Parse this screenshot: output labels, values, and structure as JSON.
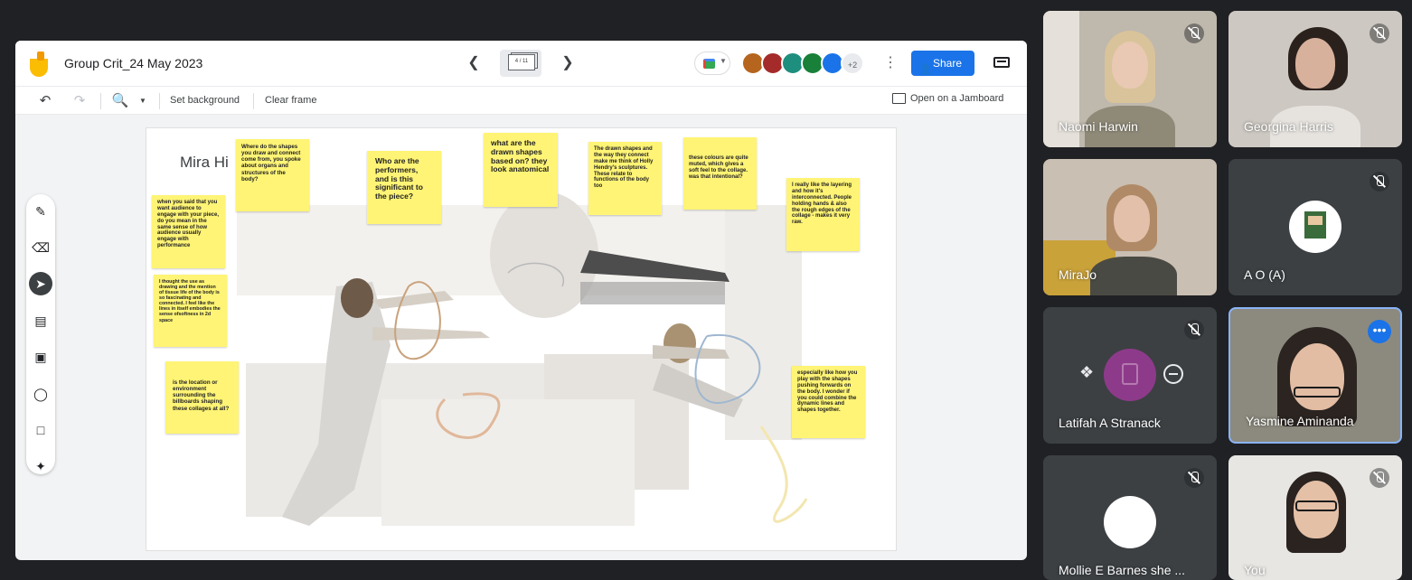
{
  "jamboard": {
    "title": "Group Crit_24 May 2023",
    "frame_indicator": "4 / 11",
    "avatars_more": "+2",
    "share_label": "Share",
    "toolbar": {
      "set_background": "Set background",
      "clear_frame": "Clear frame",
      "open_on_jamboard": "Open on a Jamboard"
    },
    "canvas_title": "Mira Hi",
    "stickies": [
      "Where do the shapes you draw and connect come from, you spoke about organs and structures of the body?",
      "Who are the performers, and is this significant to the piece?",
      "what are the drawn shapes based on? they look anatomical",
      "The drawn shapes and the way they connect make me think of Holly Hendry's sculptures. These relate to functions of the body too",
      "these colours are quite muted, which gives a soft feel to the collage. was that intentional?",
      "when you said that you want audience to engage with your piece, do you mean in the same sense of how audience usually engage with performance",
      "I really like the layering and how it's interconnected. People holding hands & also the rough edges of the collage - makes it very raw.",
      "I thought the use as drawing and the mention of tissue life of the body is so fascinating and connected. I feel like the lines in itself embodies the sense ofsoftness in 2d space",
      "is the location or environment surrounding the billboards shaping these collages at all?",
      "especially like how you play with the shapes pushing forwards on the body. I wonder if you could combine the dynamic lines and shapes together."
    ]
  },
  "meet": {
    "participants": [
      {
        "name": "Naomi Harwin"
      },
      {
        "name": "Georgina Harris"
      },
      {
        "name": "MiraJo"
      },
      {
        "name": "A O (A)"
      },
      {
        "name": "Latifah A Stranack"
      },
      {
        "name": "Yasmine Aminanda"
      },
      {
        "name": "Mollie E Barnes she ..."
      },
      {
        "name": "You"
      }
    ]
  },
  "colors": {
    "background": "#202124",
    "share_blue": "#1a73e8",
    "sticky_yellow": "#fff475",
    "latifah_avatar": "#8e3a8a",
    "active_speaker_border": "#8ab4f8"
  }
}
